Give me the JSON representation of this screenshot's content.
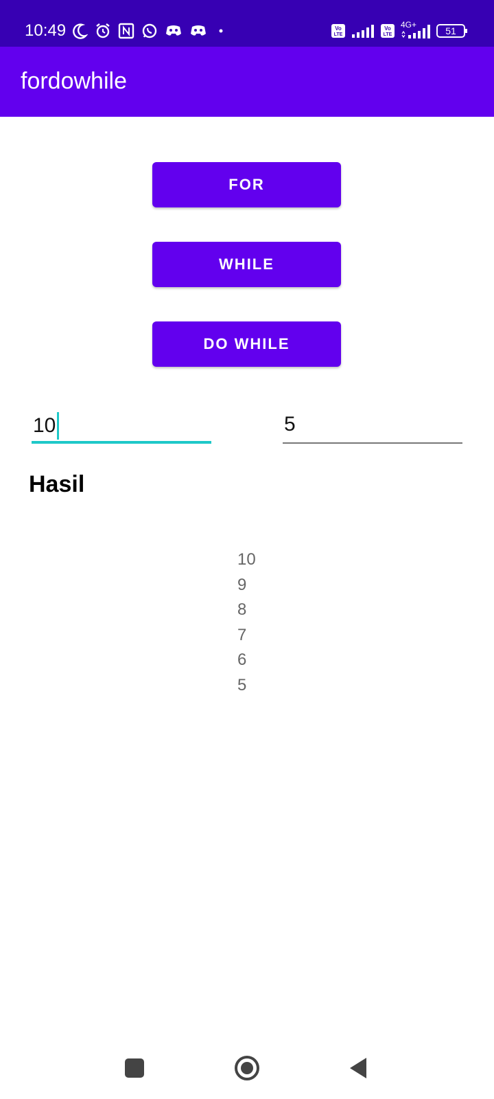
{
  "status_bar": {
    "time": "10:49",
    "network": "4G+",
    "volte_1": "Vo LTE",
    "volte_2": "Vo LTE",
    "battery": "51",
    "left_icons": [
      "moon-icon",
      "alarm-icon",
      "nfc-icon",
      "whatsapp-icon",
      "discord-icon",
      "discord-icon",
      "dot-icon"
    ]
  },
  "app_bar": {
    "title": "fordowhile"
  },
  "buttons": {
    "for": "FOR",
    "while": "WHILE",
    "do_while": "DO WHILE"
  },
  "inputs": {
    "start": {
      "value": "10"
    },
    "end": {
      "value": "5"
    }
  },
  "result": {
    "heading": "Hasil",
    "lines": [
      "10",
      "9",
      "8",
      "7",
      "6",
      "5"
    ]
  },
  "nav_bar": {
    "icons": [
      "recents-square-icon",
      "home-circle-icon",
      "back-triangle-icon"
    ]
  },
  "colors": {
    "status_bar": "#3700b3",
    "primary": "#6200ee",
    "focus_accent": "#1ec8c8",
    "result_text": "#666666"
  }
}
